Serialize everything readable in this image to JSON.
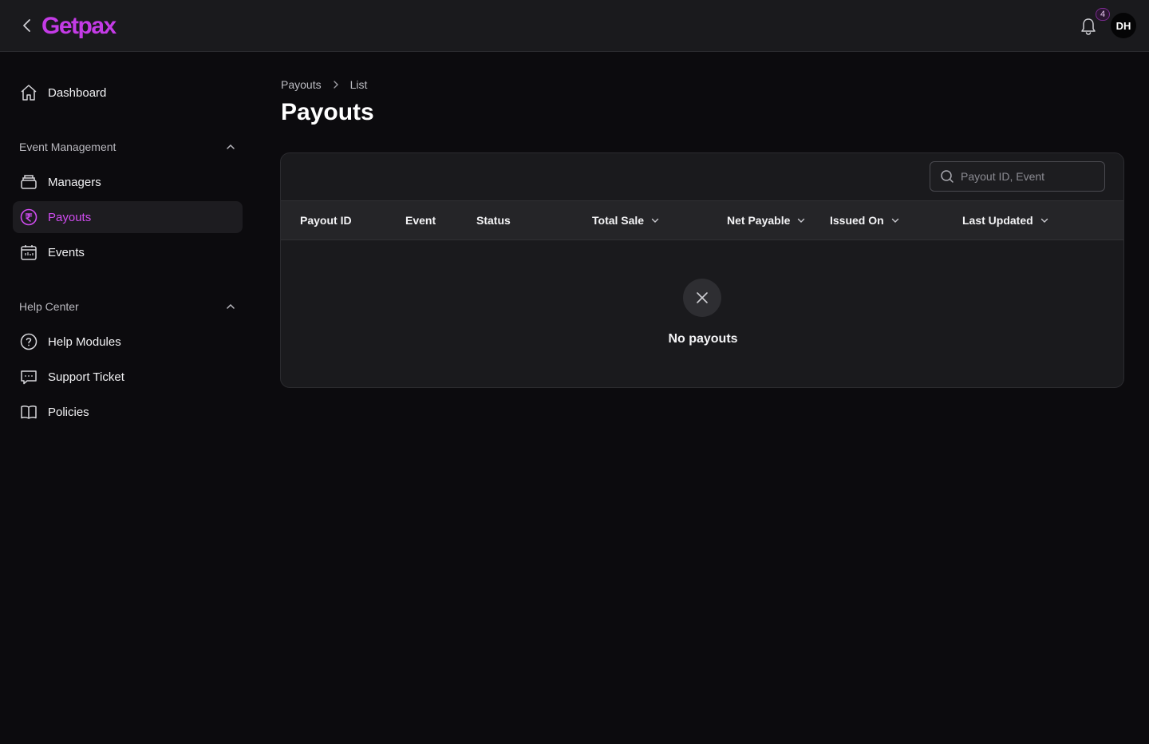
{
  "header": {
    "logo_text": "Getpax",
    "notification_count": "4",
    "user_initials": "DH",
    "brand_color": "#c43be6"
  },
  "sidebar": {
    "dashboard": "Dashboard",
    "sections": [
      {
        "title": "Event Management",
        "items": [
          "Managers",
          "Payouts",
          "Events"
        ]
      },
      {
        "title": "Help Center",
        "items": [
          "Help Modules",
          "Support Ticket",
          "Policies"
        ]
      }
    ],
    "active_item": "Payouts",
    "icons": {
      "dashboard": "home-icon",
      "managers": "stack-icon",
      "payouts": "rupee-coin-icon",
      "events": "calendar-icon",
      "help_modules": "question-circle-icon",
      "support_ticket": "chat-bubble-icon",
      "policies": "book-icon"
    }
  },
  "breadcrumb": [
    "Payouts",
    "List"
  ],
  "page_title": "Payouts",
  "search": {
    "placeholder": "Payout ID, Event"
  },
  "table": {
    "columns": [
      {
        "label": "Payout ID",
        "sortable": false
      },
      {
        "label": "Event",
        "sortable": false
      },
      {
        "label": "Status",
        "sortable": false
      },
      {
        "label": "Total Sale",
        "sortable": true
      },
      {
        "label": "Net Payable",
        "sortable": true
      },
      {
        "label": "Issued On",
        "sortable": true
      },
      {
        "label": "Last Updated",
        "sortable": true
      }
    ],
    "rows": [],
    "empty_message": "No payouts"
  }
}
